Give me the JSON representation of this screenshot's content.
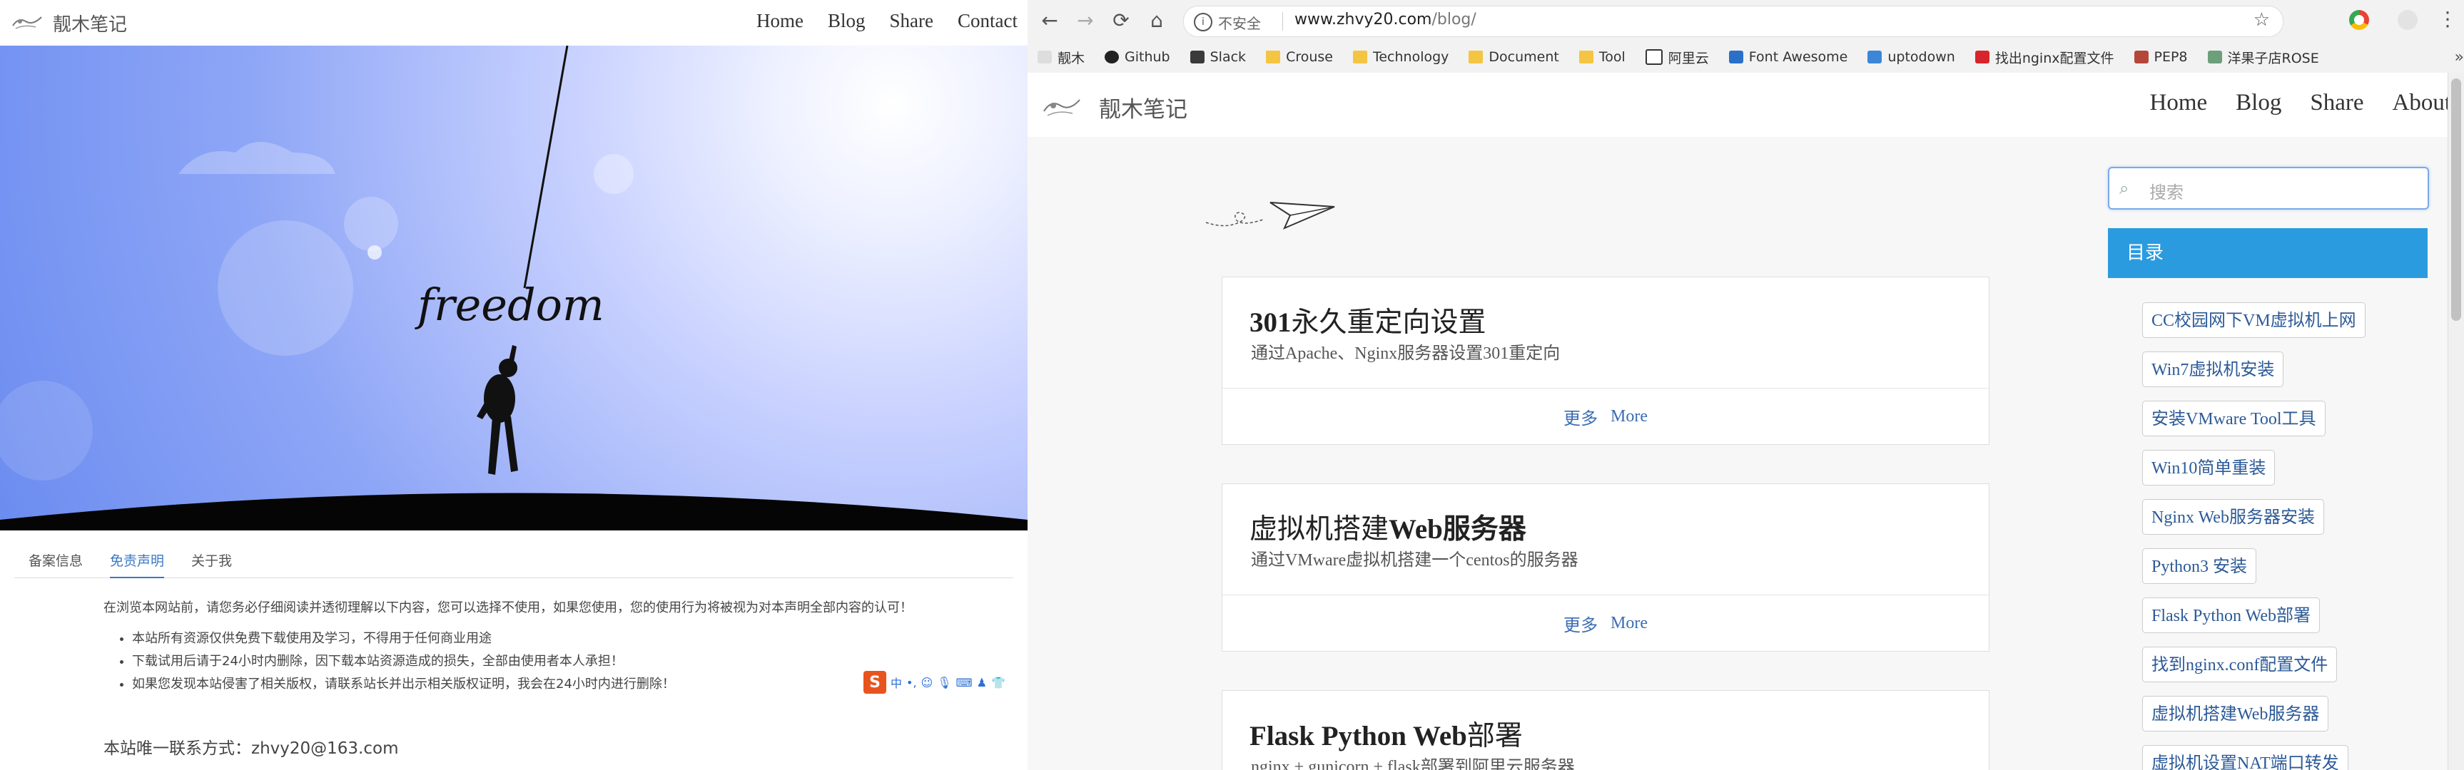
{
  "left": {
    "brand": "靓木笔记",
    "menu": [
      "Home",
      "Blog",
      "Share",
      "Contact"
    ],
    "hero_text": "freedom",
    "tabs": [
      "备案信息",
      "免责声明",
      "关于我"
    ],
    "active_tab": "免责声明",
    "notice_intro": "在浏览本网站前，请您务必仔细阅读并透彻理解以下内容，您可以选择不使用，如果您使用，您的使用行为将被视为对本声明全部内容的认可！",
    "notice_items": [
      "本站所有资源仅供免费下载使用及学习，不得用于任何商业用途",
      "下载试用后请于24小时内删除，因下载本站资源造成的损失，全部由使用者本人承担！",
      "如果您发现本站侵害了相关版权，请联系站长并出示相关版权证明，我会在24小时内进行删除！"
    ],
    "contact": "本站唯一联系方式：zhvy20@163.com",
    "ime_logo": "S",
    "ime_mode": "中"
  },
  "browser": {
    "back": "←",
    "forward": "→",
    "reload": "⟳",
    "home": "⌂",
    "security_label": "不安全",
    "url_host": "www.zhvy20.com",
    "url_path": "/blog/",
    "bookmarks": [
      {
        "label": "靓木",
        "icon": "site-icon"
      },
      {
        "label": "Github",
        "icon": "github-icon"
      },
      {
        "label": "Slack",
        "icon": "slack-icon"
      },
      {
        "label": "Crouse",
        "icon": "folder-icon"
      },
      {
        "label": "Technology",
        "icon": "folder-icon"
      },
      {
        "label": "Document",
        "icon": "folder-icon"
      },
      {
        "label": "Tool",
        "icon": "folder-icon"
      },
      {
        "label": "阿里云",
        "icon": "aliyun-icon"
      },
      {
        "label": "Font Awesome",
        "icon": "flag-icon"
      },
      {
        "label": "uptodown",
        "icon": "download-icon"
      },
      {
        "label": "找出nginx配置文件",
        "icon": "c-icon"
      },
      {
        "label": "PEP8",
        "icon": "bookmark-icon"
      },
      {
        "label": "洋果子店ROSE",
        "icon": "image-icon"
      }
    ]
  },
  "site": {
    "brand": "靓木笔记",
    "menu": [
      "Home",
      "Blog",
      "Share",
      "About"
    ],
    "posts": [
      {
        "title_a": "301",
        "title_b": "永久重定向设置",
        "desc": "通过Apache、Nginx服务器设置301重定向",
        "more_cn": "更多",
        "more_en": "More"
      },
      {
        "title_a": "虚拟机搭建",
        "title_b": "Web服务器",
        "desc": "通过VMware虚拟机搭建一个centos的服务器",
        "more_cn": "更多",
        "more_en": "More"
      },
      {
        "title_a": "Flask Python Web",
        "title_b": "部署",
        "desc": "nginx + gunicorn + flask部署到阿里云服务器",
        "more_cn": "",
        "more_en": ""
      }
    ],
    "search_placeholder": "搜索",
    "toc_title": "目录",
    "toc": [
      "CC校园网下VM虚拟机上网",
      "Win7虚拟机安装",
      "安装VMware Tool工具",
      "Win10简单重装",
      "Nginx Web服务器安装",
      "Python3 安装",
      "Flask Python Web部署",
      "找到nginx.conf配置文件",
      "虚拟机搭建Web服务器",
      "虚拟机设置NAT端口转发"
    ]
  }
}
